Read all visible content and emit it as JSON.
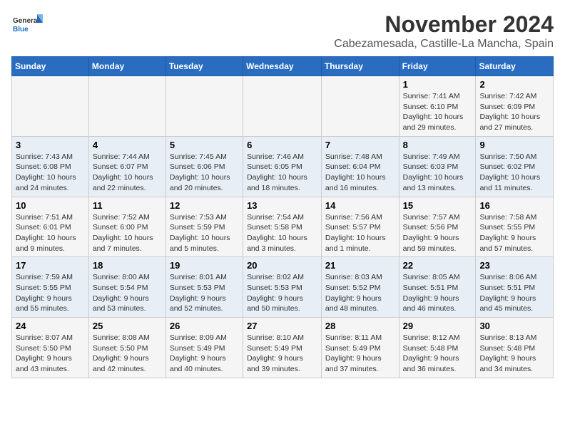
{
  "logo": {
    "general": "General",
    "blue": "Blue"
  },
  "title": "November 2024",
  "subtitle": "Cabezamesada, Castille-La Mancha, Spain",
  "days_of_week": [
    "Sunday",
    "Monday",
    "Tuesday",
    "Wednesday",
    "Thursday",
    "Friday",
    "Saturday"
  ],
  "weeks": [
    [
      {
        "day": "",
        "info": ""
      },
      {
        "day": "",
        "info": ""
      },
      {
        "day": "",
        "info": ""
      },
      {
        "day": "",
        "info": ""
      },
      {
        "day": "",
        "info": ""
      },
      {
        "day": "1",
        "info": "Sunrise: 7:41 AM\nSunset: 6:10 PM\nDaylight: 10 hours and 29 minutes."
      },
      {
        "day": "2",
        "info": "Sunrise: 7:42 AM\nSunset: 6:09 PM\nDaylight: 10 hours and 27 minutes."
      }
    ],
    [
      {
        "day": "3",
        "info": "Sunrise: 7:43 AM\nSunset: 6:08 PM\nDaylight: 10 hours and 24 minutes."
      },
      {
        "day": "4",
        "info": "Sunrise: 7:44 AM\nSunset: 6:07 PM\nDaylight: 10 hours and 22 minutes."
      },
      {
        "day": "5",
        "info": "Sunrise: 7:45 AM\nSunset: 6:06 PM\nDaylight: 10 hours and 20 minutes."
      },
      {
        "day": "6",
        "info": "Sunrise: 7:46 AM\nSunset: 6:05 PM\nDaylight: 10 hours and 18 minutes."
      },
      {
        "day": "7",
        "info": "Sunrise: 7:48 AM\nSunset: 6:04 PM\nDaylight: 10 hours and 16 minutes."
      },
      {
        "day": "8",
        "info": "Sunrise: 7:49 AM\nSunset: 6:03 PM\nDaylight: 10 hours and 13 minutes."
      },
      {
        "day": "9",
        "info": "Sunrise: 7:50 AM\nSunset: 6:02 PM\nDaylight: 10 hours and 11 minutes."
      }
    ],
    [
      {
        "day": "10",
        "info": "Sunrise: 7:51 AM\nSunset: 6:01 PM\nDaylight: 10 hours and 9 minutes."
      },
      {
        "day": "11",
        "info": "Sunrise: 7:52 AM\nSunset: 6:00 PM\nDaylight: 10 hours and 7 minutes."
      },
      {
        "day": "12",
        "info": "Sunrise: 7:53 AM\nSunset: 5:59 PM\nDaylight: 10 hours and 5 minutes."
      },
      {
        "day": "13",
        "info": "Sunrise: 7:54 AM\nSunset: 5:58 PM\nDaylight: 10 hours and 3 minutes."
      },
      {
        "day": "14",
        "info": "Sunrise: 7:56 AM\nSunset: 5:57 PM\nDaylight: 10 hours and 1 minute."
      },
      {
        "day": "15",
        "info": "Sunrise: 7:57 AM\nSunset: 5:56 PM\nDaylight: 9 hours and 59 minutes."
      },
      {
        "day": "16",
        "info": "Sunrise: 7:58 AM\nSunset: 5:55 PM\nDaylight: 9 hours and 57 minutes."
      }
    ],
    [
      {
        "day": "17",
        "info": "Sunrise: 7:59 AM\nSunset: 5:55 PM\nDaylight: 9 hours and 55 minutes."
      },
      {
        "day": "18",
        "info": "Sunrise: 8:00 AM\nSunset: 5:54 PM\nDaylight: 9 hours and 53 minutes."
      },
      {
        "day": "19",
        "info": "Sunrise: 8:01 AM\nSunset: 5:53 PM\nDaylight: 9 hours and 52 minutes."
      },
      {
        "day": "20",
        "info": "Sunrise: 8:02 AM\nSunset: 5:53 PM\nDaylight: 9 hours and 50 minutes."
      },
      {
        "day": "21",
        "info": "Sunrise: 8:03 AM\nSunset: 5:52 PM\nDaylight: 9 hours and 48 minutes."
      },
      {
        "day": "22",
        "info": "Sunrise: 8:05 AM\nSunset: 5:51 PM\nDaylight: 9 hours and 46 minutes."
      },
      {
        "day": "23",
        "info": "Sunrise: 8:06 AM\nSunset: 5:51 PM\nDaylight: 9 hours and 45 minutes."
      }
    ],
    [
      {
        "day": "24",
        "info": "Sunrise: 8:07 AM\nSunset: 5:50 PM\nDaylight: 9 hours and 43 minutes."
      },
      {
        "day": "25",
        "info": "Sunrise: 8:08 AM\nSunset: 5:50 PM\nDaylight: 9 hours and 42 minutes."
      },
      {
        "day": "26",
        "info": "Sunrise: 8:09 AM\nSunset: 5:49 PM\nDaylight: 9 hours and 40 minutes."
      },
      {
        "day": "27",
        "info": "Sunrise: 8:10 AM\nSunset: 5:49 PM\nDaylight: 9 hours and 39 minutes."
      },
      {
        "day": "28",
        "info": "Sunrise: 8:11 AM\nSunset: 5:49 PM\nDaylight: 9 hours and 37 minutes."
      },
      {
        "day": "29",
        "info": "Sunrise: 8:12 AM\nSunset: 5:48 PM\nDaylight: 9 hours and 36 minutes."
      },
      {
        "day": "30",
        "info": "Sunrise: 8:13 AM\nSunset: 5:48 PM\nDaylight: 9 hours and 34 minutes."
      }
    ]
  ]
}
